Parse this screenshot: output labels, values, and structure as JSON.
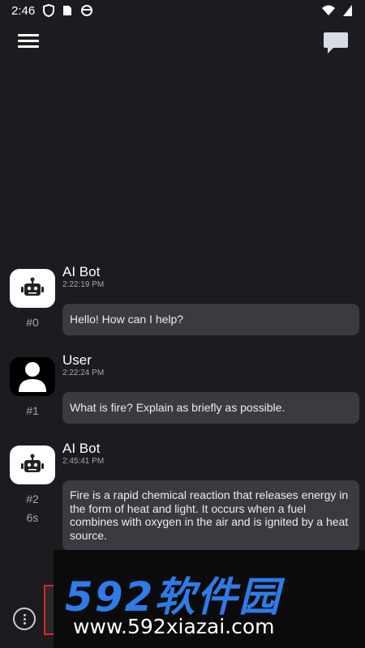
{
  "status_bar": {
    "time": "2:46",
    "icons": [
      "shield-icon",
      "sim-card-icon",
      "vpn-icon",
      "wifi-icon",
      "battery-icon"
    ]
  },
  "app_bar": {
    "left_icon": "hamburger-menu-icon",
    "right_icon": "chat-bubble-icon"
  },
  "messages": [
    {
      "sender": "AI Bot",
      "time": "2:22:19 PM",
      "index": "#0",
      "extra": "",
      "text": "Hello! How can I help?",
      "avatar": "robot-icon"
    },
    {
      "sender": "User",
      "time": "2:22:24 PM",
      "index": "#1",
      "extra": "",
      "text": "What is fire? Explain as briefly as possible.",
      "avatar": "person-icon"
    },
    {
      "sender": "AI Bot",
      "time": "2:45:41 PM",
      "index": "#2",
      "extra": "6s",
      "text": "Fire is a rapid chemical reaction that releases energy in the form of heat and light. It occurs when a fuel combines with oxygen in the air and is ignited by a heat source.",
      "avatar": "robot-icon"
    }
  ],
  "bottom_bar": {
    "more_icon": "more-options-icon"
  },
  "watermark": {
    "logo": "592软件园",
    "url": "www.592xiazai.com"
  },
  "colors": {
    "background": "#1c1b1f",
    "bubble": "#3b3a40",
    "highlight_box": "#e0261f",
    "watermark_blue": "#2f7be8"
  }
}
